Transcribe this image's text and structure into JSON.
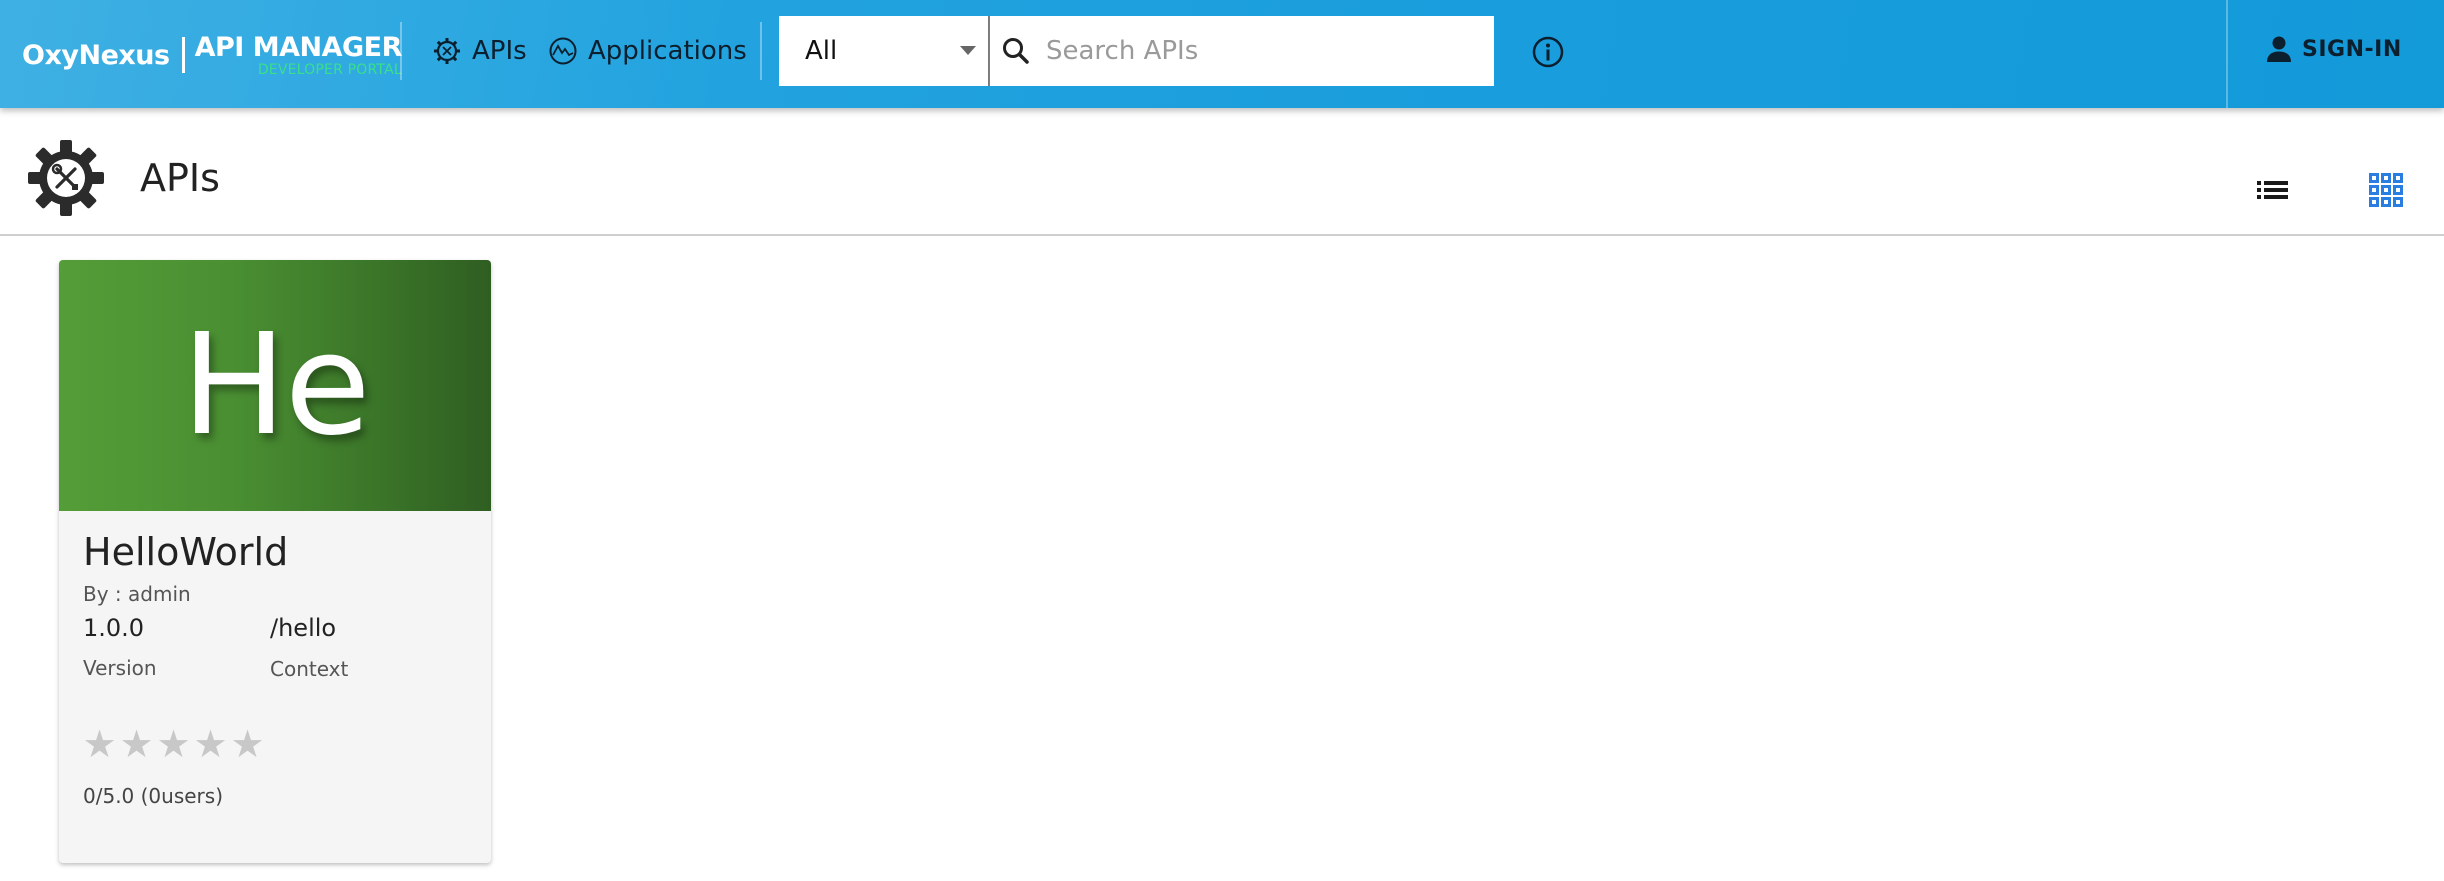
{
  "header": {
    "logo_brand": "OxyNexus",
    "logo_product": "API MANAGER",
    "logo_subtitle": "DEVELOPER PORTAL",
    "nav": {
      "apis_label": "APIs",
      "applications_label": "Applications"
    },
    "search": {
      "filter_value": "All",
      "placeholder": "Search APIs"
    },
    "signin_label": "SIGN-IN"
  },
  "page": {
    "title": "APIs"
  },
  "api_cards": [
    {
      "thumbnail_text": "He",
      "name": "HelloWorld",
      "by": "By : admin",
      "version": "1.0.0",
      "version_label": "Version",
      "context": "/hello",
      "context_label": "Context",
      "rating_stars": 0,
      "rating_text": "0/5.0 (0users)"
    }
  ],
  "colors": {
    "header_bg": "#1a9ddc",
    "grid_view_active": "#2a7de1",
    "thumbnail_green": "#4a8f32",
    "logo_subtitle": "#38e08a"
  }
}
